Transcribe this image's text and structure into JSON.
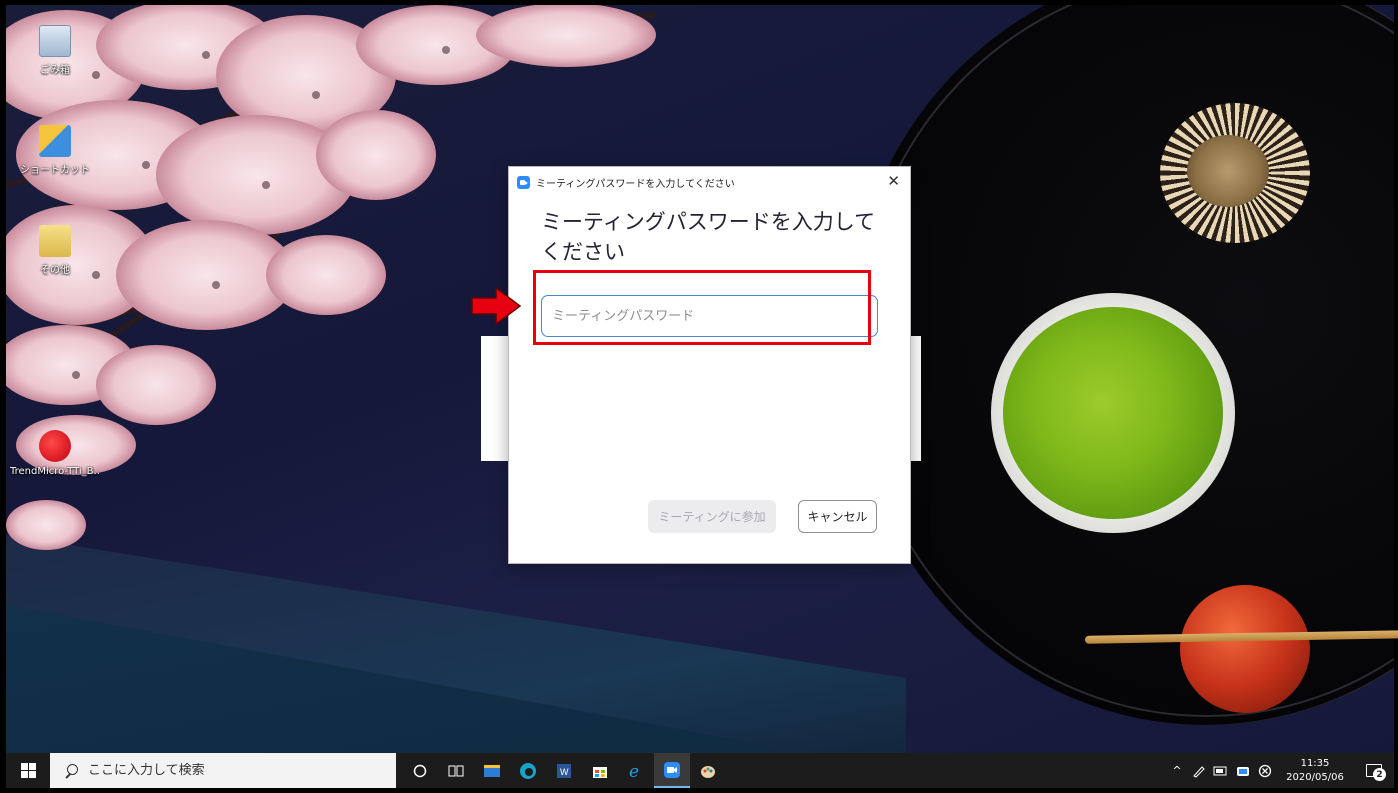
{
  "desktop": {
    "icons": [
      {
        "label": "ごみ箱",
        "icon": "recycle-bin-icon"
      },
      {
        "label": "ショートカット",
        "icon": "shortcut-folder-icon"
      },
      {
        "label": "その他",
        "icon": "other-folder-icon"
      },
      {
        "label": "TrendMicro-TTi_B...",
        "icon": "trendmicro-icon"
      }
    ]
  },
  "dialog": {
    "window_title": "ミーティングパスワードを入力してください",
    "heading": "ミーティングパスワードを入力してください",
    "password_placeholder": "ミーティングパスワード",
    "password_value": "",
    "join_button": "ミーティングに参加",
    "join_enabled": false,
    "cancel_button": "キャンセル",
    "close_glyph": "✕"
  },
  "annotation": {
    "highlight_color": "#e60012",
    "arrow_color": "#e60012"
  },
  "taskbar": {
    "search_placeholder": "ここに入力して検索",
    "pinned": [
      "cortana-icon",
      "task-view-icon",
      "file-explorer-icon",
      "edge-icon",
      "word-icon",
      "store-icon",
      "internet-explorer-icon",
      "zoom-icon",
      "paint-icon"
    ],
    "tray_chevron": "^",
    "time": "11:35",
    "date": "2020/05/06",
    "notification_count": "2"
  }
}
